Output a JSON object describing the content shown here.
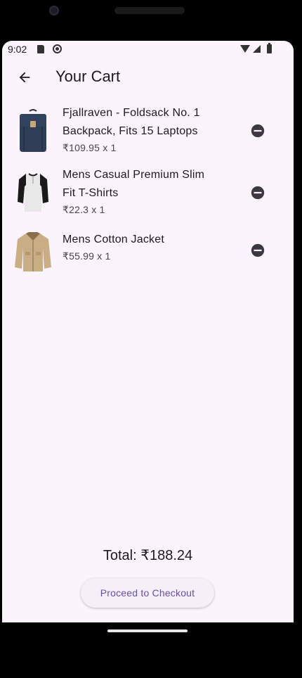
{
  "status_bar": {
    "time": "9:02"
  },
  "app_bar": {
    "title": "Your Cart",
    "back_icon": "arrow-back-icon"
  },
  "cart": {
    "items": [
      {
        "title_line1": "Fjallraven - Foldsack No. 1",
        "title_line2": "Backpack, Fits 15 Laptops",
        "price": "₹109.95 x 1",
        "image": "backpack"
      },
      {
        "title_line1": "Mens Casual Premium Slim",
        "title_line2": "Fit T-Shirts",
        "price": "₹22.3 x 1",
        "image": "t-shirt"
      },
      {
        "title_line1": "Mens Cotton Jacket",
        "title_line2": "",
        "price": "₹55.99 x 1",
        "image": "jacket"
      }
    ],
    "remove_icon": "remove-circle-icon"
  },
  "footer": {
    "total": "Total: ₹188.24",
    "checkout_label": "Proceed to Checkout"
  },
  "colors": {
    "background": "#fcf4fc",
    "accent": "#6750a4",
    "text": "#1d1b20"
  }
}
